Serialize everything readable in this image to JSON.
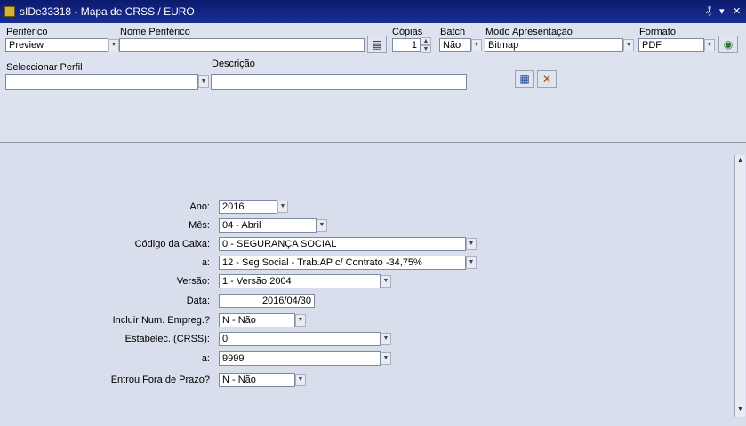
{
  "window": {
    "title": "sIDe33318 - Mapa de CRSS / EURO",
    "controls": [
      "₰",
      "▾",
      "✕"
    ]
  },
  "top": {
    "periferico": {
      "label": "Periférico",
      "value": "Preview"
    },
    "nome_periferico": {
      "label": "Nome Periférico",
      "value": ""
    },
    "copias": {
      "label": "Cópias",
      "value": "1"
    },
    "batch": {
      "label": "Batch",
      "value": "Não"
    },
    "modo_apresentacao": {
      "label": "Modo Apresentação",
      "value": "Bitmap"
    },
    "formato": {
      "label": "Formato",
      "value": "PDF"
    },
    "seleccionar_perfil": {
      "label": "Seleccionar Perfil",
      "value": ""
    },
    "descricao": {
      "label": "Descrição",
      "value": ""
    }
  },
  "form": {
    "ano": {
      "label": "Ano:",
      "value": "2016"
    },
    "mes": {
      "label": "Mês:",
      "value": "04 - Abril"
    },
    "codigo_caixa": {
      "label": "Código da Caixa:",
      "value": "0 - SEGURANÇA SOCIAL"
    },
    "a1": {
      "label": "a:",
      "value": "12 - Seg Social - Trab.AP c/ Contrato -34,75%"
    },
    "versao": {
      "label": "Versão:",
      "value": "1 - Versão 2004"
    },
    "data": {
      "label": "Data:",
      "value": "2016/04/30"
    },
    "incluir_num_empreg": {
      "label": "Incluir Num. Empreg.?",
      "value": "N - Não"
    },
    "estabelec": {
      "label": "Estabelec. (CRSS):",
      "value": "0"
    },
    "a2": {
      "label": "a:",
      "value": "9999"
    },
    "entrou_fora_prazo": {
      "label": "Entrou Fora de Prazo?",
      "value": "N - Não"
    }
  },
  "icons": {
    "app": "app-icon",
    "print": "printer-icon",
    "save_profile": "save-icon",
    "delete_profile": "delete-icon",
    "go": "run-icon"
  }
}
